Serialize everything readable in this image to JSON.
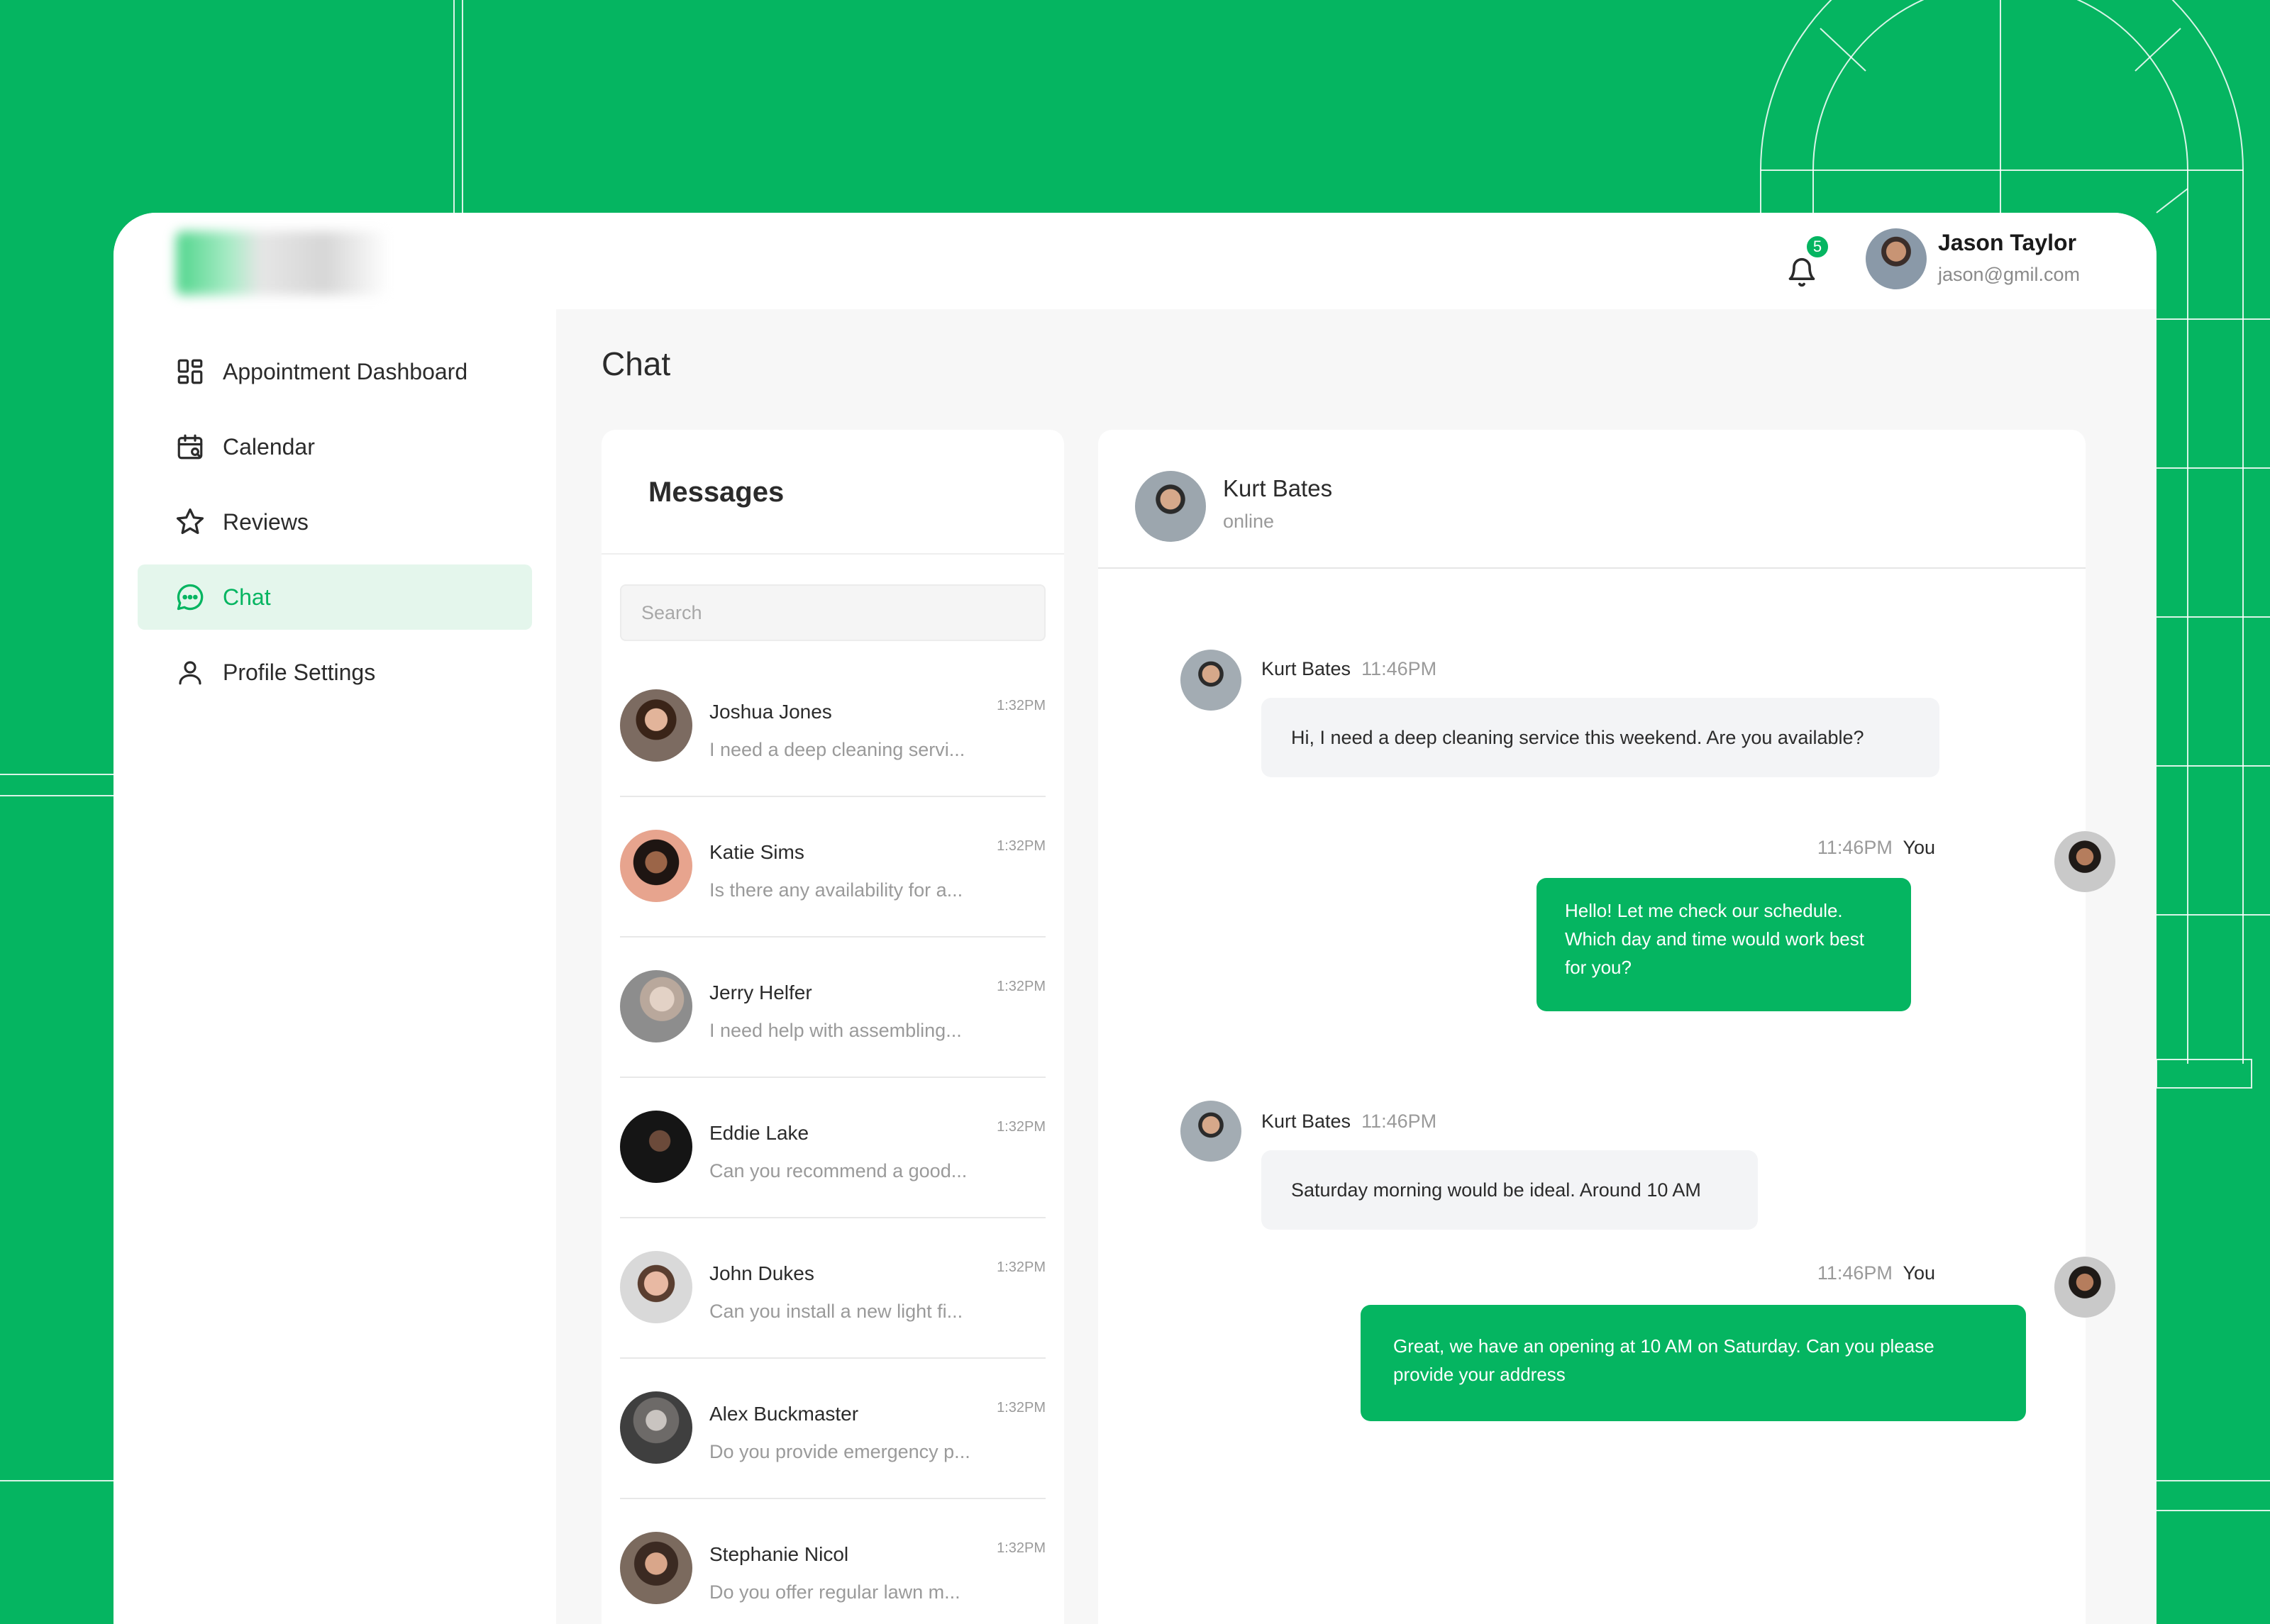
{
  "colors": {
    "accent": "#05b561",
    "accent_light": "#e4f6ec"
  },
  "header": {
    "notification_count": "5",
    "user": {
      "name": "Jason Taylor",
      "email": "jason@gmil.com"
    }
  },
  "sidebar": {
    "items": [
      {
        "label": "Appointment Dashboard",
        "icon": "dashboard-grid-icon"
      },
      {
        "label": "Calendar",
        "icon": "calendar-icon"
      },
      {
        "label": "Reviews",
        "icon": "star-icon"
      },
      {
        "label": "Chat",
        "icon": "chat-bubble-icon",
        "active": true
      },
      {
        "label": "Profile Settings",
        "icon": "user-icon"
      }
    ]
  },
  "page": {
    "title": "Chat"
  },
  "messages": {
    "title": "Messages",
    "search_placeholder": "Search",
    "conversations": [
      {
        "name": "Joshua Jones",
        "preview": "I need a deep cleaning servi...",
        "time": "1:32PM"
      },
      {
        "name": "Katie Sims",
        "preview": "Is there any availability for a...",
        "time": "1:32PM"
      },
      {
        "name": "Jerry Helfer",
        "preview": "I need help with assembling...",
        "time": "1:32PM"
      },
      {
        "name": "Eddie Lake",
        "preview": "Can you recommend a good...",
        "time": "1:32PM"
      },
      {
        "name": "John Dukes",
        "preview": "Can you install a new light fi...",
        "time": "1:32PM"
      },
      {
        "name": "Alex Buckmaster",
        "preview": "Do you provide emergency p...",
        "time": "1:32PM"
      },
      {
        "name": "Stephanie Nicol",
        "preview": "Do you offer regular lawn m...",
        "time": "1:32PM"
      }
    ]
  },
  "chat": {
    "contact": {
      "name": "Kurt Bates",
      "status": "online"
    },
    "thread": [
      {
        "sender": "Kurt Bates",
        "time": "11:46PM",
        "text": "Hi, I need a deep cleaning service this weekend. Are you available?"
      },
      {
        "sender": "You",
        "time": "11:46PM",
        "text": "Hello! Let me check our schedule. Which day and time would work best for you?"
      },
      {
        "sender": "Kurt Bates",
        "time": "11:46PM",
        "text": "Saturday morning would be ideal. Around 10 AM"
      },
      {
        "sender": "You",
        "time": "11:46PM",
        "text": "Great, we have an opening at 10 AM on Saturday. Can you please provide your address"
      }
    ]
  }
}
